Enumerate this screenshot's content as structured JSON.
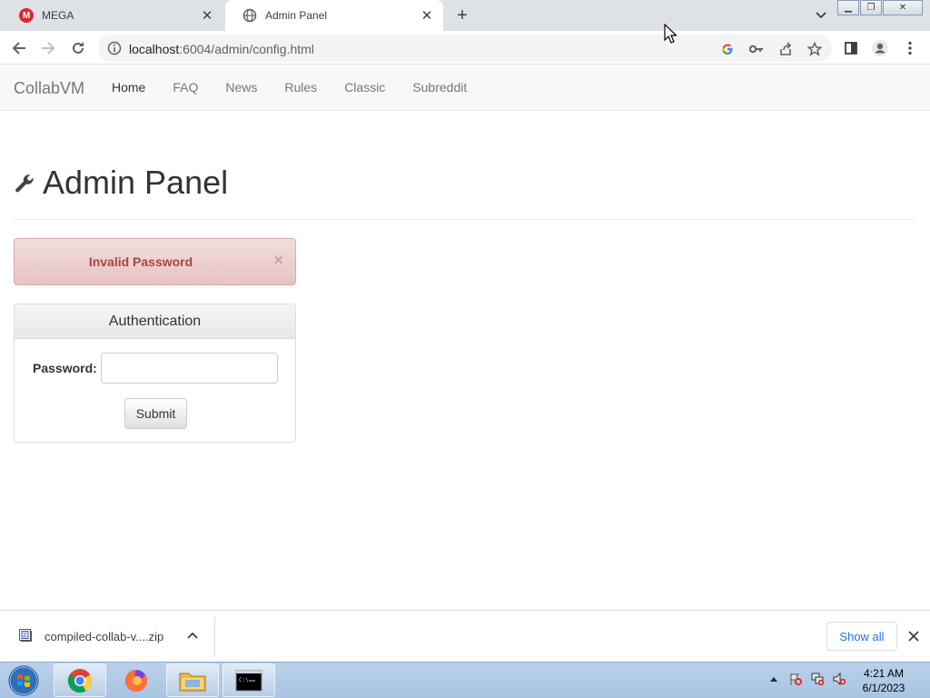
{
  "browser": {
    "tabs": [
      {
        "title": "MEGA",
        "favicon": "mega-logo",
        "active": false
      },
      {
        "title": "Admin Panel",
        "favicon": "globe-icon",
        "active": true
      }
    ],
    "address": {
      "host": "localhost",
      "path": ":6004/admin/config.html"
    }
  },
  "site": {
    "brand": "CollabVM",
    "nav": [
      "Home",
      "FAQ",
      "News",
      "Rules",
      "Classic",
      "Subreddit"
    ],
    "active_nav": "Home"
  },
  "page": {
    "title": "Admin Panel",
    "title_icon": "wrench-icon",
    "alert": {
      "message": "Invalid Password",
      "close": "×"
    },
    "auth_panel": {
      "heading": "Authentication",
      "password_label": "Password:",
      "password_value": "",
      "submit_label": "Submit"
    }
  },
  "downloads": {
    "file_name": "compiled-collab-v....zip",
    "show_all_label": "Show all"
  },
  "taskbar": {
    "time": "4:21 AM",
    "date": "6/1/2023"
  },
  "colors": {
    "alert_text": "#a94442",
    "alert_bg": "#f2dede",
    "link_blue": "#1a73e8",
    "mega_red": "#d9272e"
  }
}
